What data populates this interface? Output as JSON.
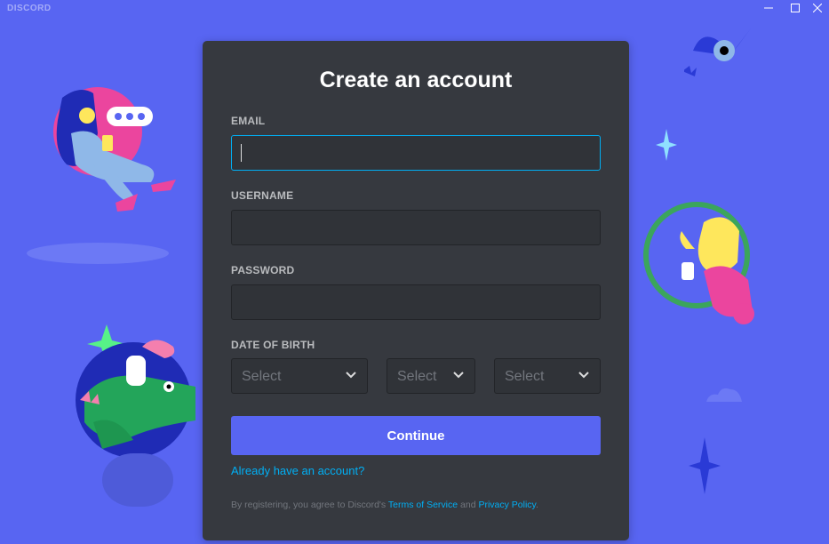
{
  "window": {
    "app_name": "DISCORD",
    "controls": [
      "minimize",
      "maximize",
      "close"
    ]
  },
  "colors": {
    "background": "#5865F2",
    "card": "#36393F",
    "input": "#303338",
    "input_focus_border": "#00AFF4",
    "accent": "#5865F2",
    "link": "#00AFF4",
    "label": "#B9BBBE",
    "muted": "#72767D"
  },
  "form": {
    "title": "Create an account",
    "email": {
      "label": "EMAIL",
      "value": "",
      "focused": true
    },
    "username": {
      "label": "USERNAME",
      "value": ""
    },
    "password": {
      "label": "PASSWORD",
      "value": ""
    },
    "dob": {
      "label": "DATE OF BIRTH",
      "month": "Select",
      "day": "Select",
      "year": "Select"
    },
    "continue_label": "Continue",
    "login_link": "Already have an account?",
    "legal": {
      "prefix": "By registering, you agree to Discord's ",
      "terms": "Terms of Service",
      "and": " and ",
      "privacy": "Privacy Policy",
      "suffix": "."
    }
  },
  "icons": {
    "dropdown": "chevron-down-icon",
    "minimize": "minimize-icon",
    "maximize": "maximize-icon",
    "close": "close-icon"
  }
}
